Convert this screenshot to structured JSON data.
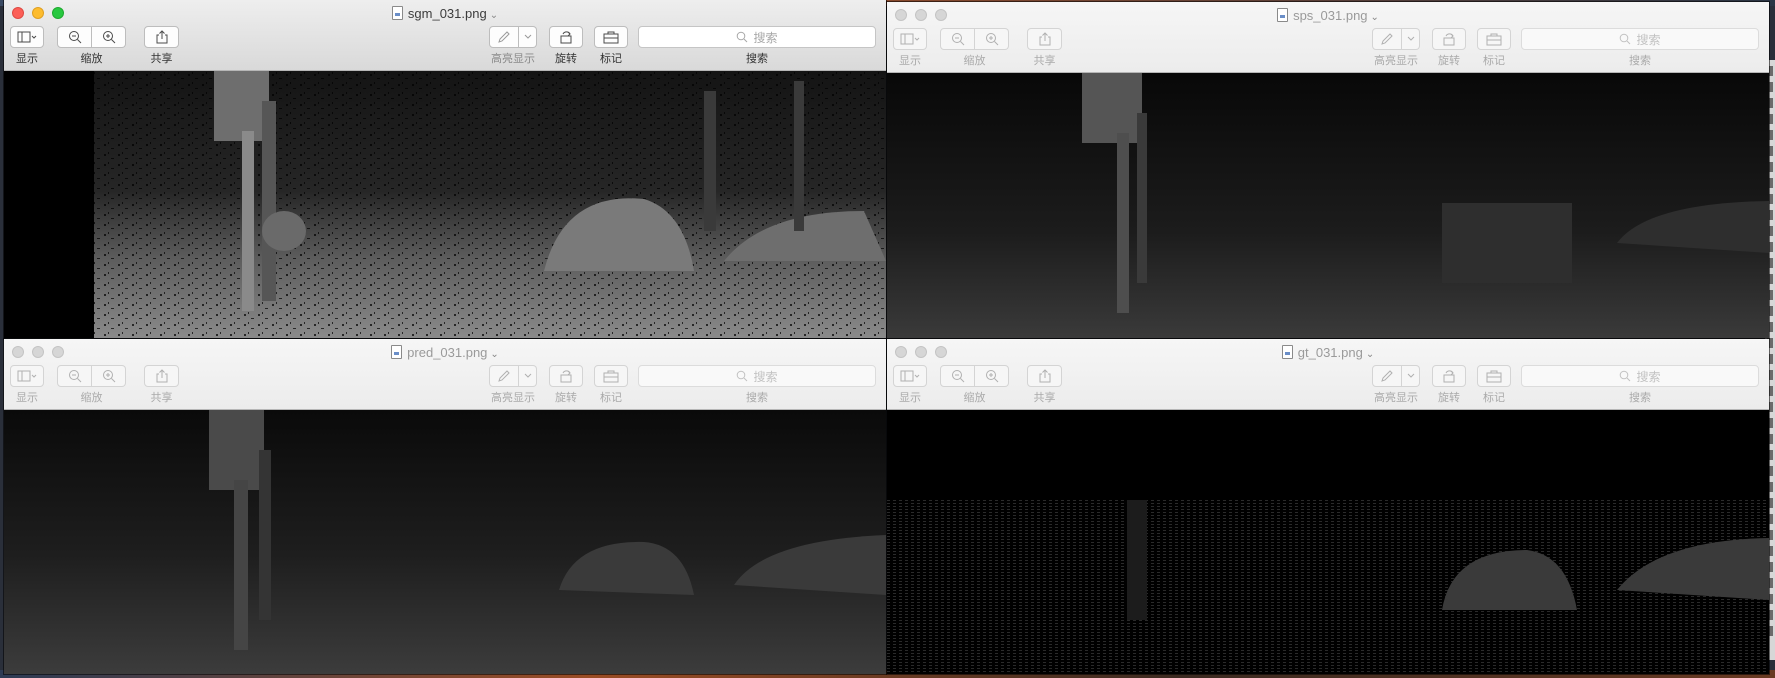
{
  "toolbar_labels": {
    "view": "显示",
    "zoom": "缩放",
    "share": "共享",
    "highlight": "高亮显示",
    "rotate": "旋转",
    "markup": "标记",
    "search": "搜索",
    "search_placeholder": "搜索"
  },
  "windows": [
    {
      "title": "sgm_031.png",
      "state": "active"
    },
    {
      "title": "sps_031.png",
      "state": "inactive"
    },
    {
      "title": "pred_031.png",
      "state": "inactive"
    },
    {
      "title": "gt_031.png",
      "state": "inactive"
    }
  ],
  "colors": {
    "close": "#fc5f57",
    "minimize": "#fdbc2e",
    "maximize": "#28c840",
    "image_background": "#000000"
  },
  "icons": [
    "sidebar-icon",
    "chevron-down-icon",
    "zoom-out-icon",
    "zoom-in-icon",
    "share-icon",
    "pen-icon",
    "rotate-icon",
    "toolbox-icon",
    "search-icon",
    "document-icon"
  ]
}
